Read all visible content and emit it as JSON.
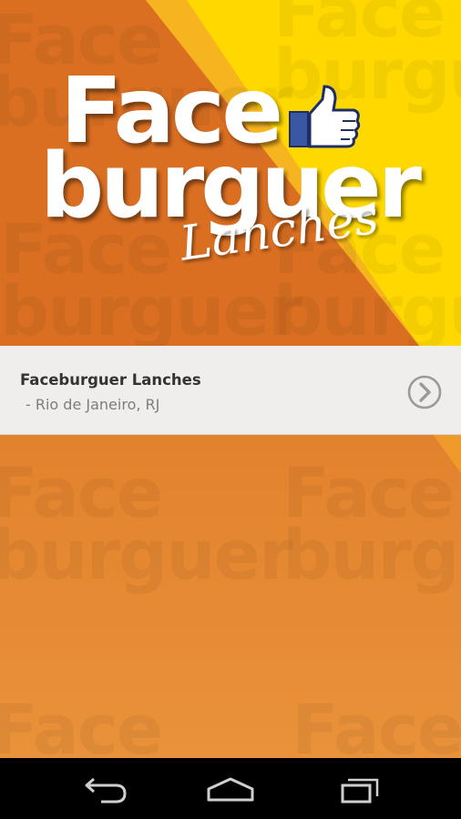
{
  "brand": {
    "logo_word_1": "Face",
    "logo_word_2": "burguer",
    "logo_word_3": "Lanches",
    "colors": {
      "orange": "#e07a26",
      "yellow": "#ffd800",
      "row_bg": "#efeeec",
      "thumb_blue": "#3a57a4"
    }
  },
  "listing": {
    "items": [
      {
        "title": "Faceburguer Lanches",
        "subtitle": " - Rio de Janeiro, RJ",
        "action_icon": "chevron-right-circle-icon"
      }
    ]
  },
  "navigation_bar": {
    "back_icon": "back-icon",
    "home_icon": "home-icon",
    "recents_icon": "recent-apps-icon"
  }
}
